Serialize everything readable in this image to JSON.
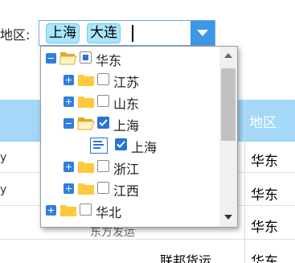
{
  "filter": {
    "label": "地区:",
    "selected_tags": [
      "上海",
      "大连"
    ]
  },
  "table": {
    "header_col": "地区",
    "rows": [
      {
        "region": "华东",
        "left_fragment": "y"
      },
      {
        "region": "华东",
        "left_fragment": "y"
      },
      {
        "region": "华东",
        "left_fragment": ""
      },
      {
        "region": "华东",
        "company": "联邦货运"
      }
    ],
    "partial_text": "东方发运"
  },
  "tree": {
    "items": [
      {
        "label": "华东",
        "level": 0,
        "expander": "minus",
        "folder": "open",
        "check": "partial"
      },
      {
        "label": "江苏",
        "level": 1,
        "expander": "plus",
        "folder": "closed",
        "check": "none"
      },
      {
        "label": "山东",
        "level": 1,
        "expander": "plus",
        "folder": "closed",
        "check": "none"
      },
      {
        "label": "上海",
        "level": 1,
        "expander": "minus",
        "folder": "open",
        "check": "checked"
      },
      {
        "label": "上海",
        "level": 2,
        "expander": "none",
        "folder": "leaf",
        "check": "checked"
      },
      {
        "label": "浙江",
        "level": 1,
        "expander": "plus",
        "folder": "closed",
        "check": "none"
      },
      {
        "label": "江西",
        "level": 1,
        "expander": "plus",
        "folder": "closed",
        "check": "none"
      },
      {
        "label": "华北",
        "level": 0,
        "expander": "plus",
        "folder": "closed",
        "check": "none"
      }
    ]
  },
  "colors": {
    "accent": "#3d96e6",
    "tag_bg": "#a9e6fc",
    "header_bg": "#a3d8f8",
    "folder": "#ffc83d",
    "check": "#2a73d6"
  }
}
